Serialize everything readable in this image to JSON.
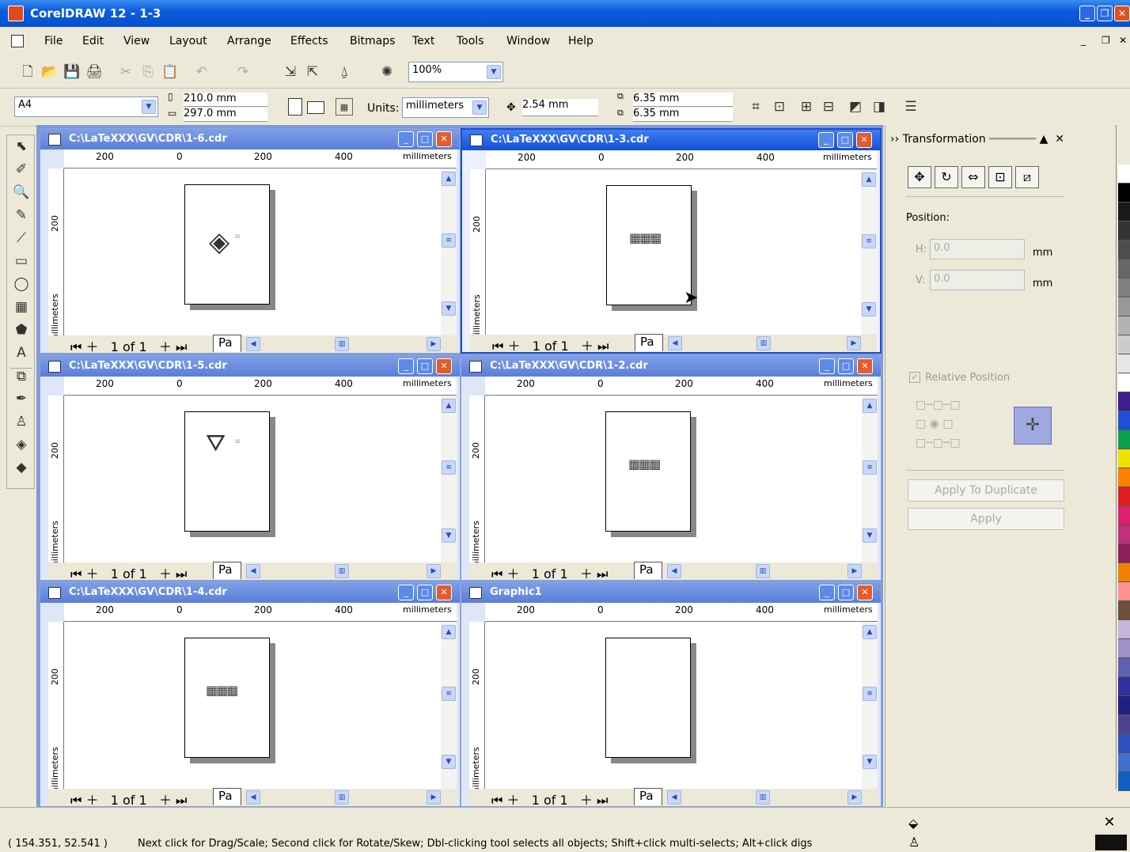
{
  "app": {
    "title": "CorelDRAW 12 - 1-3"
  },
  "menu": [
    "File",
    "Edit",
    "View",
    "Layout",
    "Arrange",
    "Effects",
    "Bitmaps",
    "Text",
    "Tools",
    "Window",
    "Help"
  ],
  "toolbar": {
    "zoom": "100%"
  },
  "propbar": {
    "page_size": "A4",
    "width": "210.0 mm",
    "height": "297.0 mm",
    "units_label": "Units:",
    "units": "millimeters",
    "nudge": "2.54 mm",
    "dup_x": "6.35 mm",
    "dup_y": "6.35 mm"
  },
  "toolbox_icons": [
    "pick-tool-icon",
    "shape-tool-icon",
    "zoom-tool-icon",
    "freehand-tool-icon",
    "smart-fill-tool-icon",
    "rectangle-tool-icon",
    "ellipse-tool-icon",
    "graph-paper-tool-icon",
    "basic-shapes-tool-icon",
    "text-tool-icon",
    "interactive-blend-tool-icon",
    "eyedropper-tool-icon",
    "outline-tool-icon",
    "fill-tool-icon",
    "interactive-fill-tool-icon"
  ],
  "docs": [
    {
      "title": "C:\\LaTeXXX\\GV\\CDR\\1-6.cdr",
      "page_nav": "1 of 1",
      "page_tab": "Pa",
      "art": "diamond"
    },
    {
      "title": "C:\\LaTeXXX\\GV\\CDR\\1-3.cdr",
      "page_nav": "1 of 1",
      "page_tab": "Pa",
      "art": "grid"
    },
    {
      "title": "C:\\LaTeXXX\\GV\\CDR\\1-5.cdr",
      "page_nav": "1 of 1",
      "page_tab": "Pa",
      "art": "fan"
    },
    {
      "title": "C:\\LaTeXXX\\GV\\CDR\\1-2.cdr",
      "page_nav": "1 of 1",
      "page_tab": "Pa",
      "art": "grid"
    },
    {
      "title": "C:\\LaTeXXX\\GV\\CDR\\1-4.cdr",
      "page_nav": "1 of 1",
      "page_tab": "Pa",
      "art": "grid"
    },
    {
      "title": "Graphic1",
      "page_nav": "1 of 1",
      "page_tab": "Pa",
      "art": "none"
    }
  ],
  "ruler": {
    "ticks": [
      "200",
      "0",
      "200",
      "400"
    ],
    "units": "millimeters",
    "v_tick": "200",
    "v_units": "millimeters"
  },
  "docker": {
    "title": "Transformation",
    "position_label": "Position:",
    "h_label": "H:",
    "h_value": "0.0",
    "v_label": "V:",
    "v_value": "0.0",
    "unit": "mm",
    "relative_position": "Relative Position",
    "apply_duplicate": "Apply To Duplicate",
    "apply": "Apply"
  },
  "palette_colors": [
    "#ffffff",
    "#000000",
    "#1a1a1a",
    "#333333",
    "#4d4d4d",
    "#666666",
    "#808080",
    "#999999",
    "#b3b3b3",
    "#cccccc",
    "#e6e6e6",
    "#ffffff",
    "#3c1f8c",
    "#1e4fd8",
    "#0aa050",
    "#f0e000",
    "#ff8000",
    "#e02020",
    "#e01e6e",
    "#c0307c",
    "#8c1e5a",
    "#f08000",
    "#ff9090",
    "#6e4e3c",
    "#c8b4dc",
    "#a090c8",
    "#6060b0",
    "#3030a0",
    "#202080",
    "#504090",
    "#3050c0",
    "#4070d0",
    "#1060c0"
  ],
  "status": {
    "coords": "( 154.351, 52.541 )",
    "message": "Next click for Drag/Scale; Second click for Rotate/Skew; Dbl-clicking tool selects all objects; Shift+click multi-selects; Alt+click digs"
  }
}
